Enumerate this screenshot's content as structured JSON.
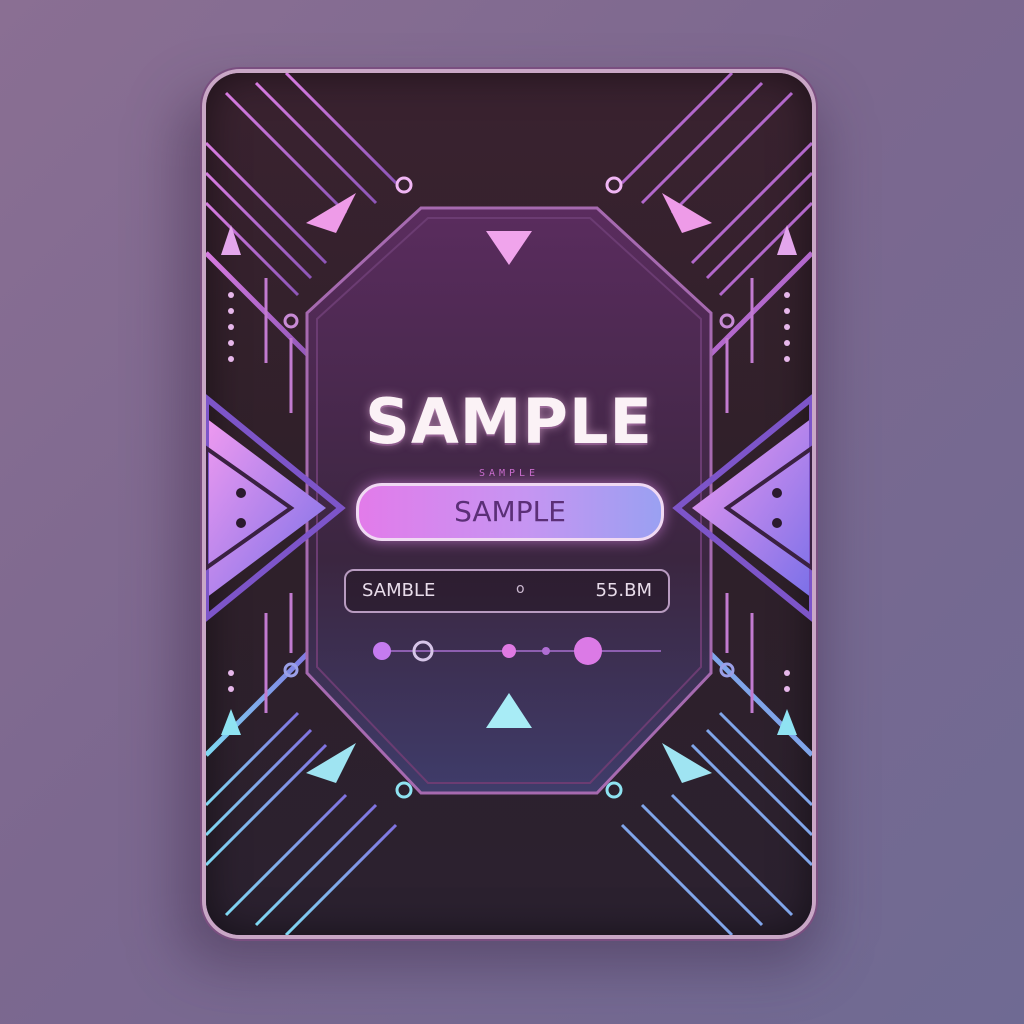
{
  "card": {
    "title": "SAMPLE",
    "subtitle": "SAMPLE",
    "button_label": "SAMPLE",
    "info_label": "SAMBLE",
    "info_mid": "o",
    "info_value": "55.BM"
  },
  "icons": {
    "top_left_arrow": "arrow-down-right-icon",
    "top_right_arrow": "arrow-down-left-icon",
    "bottom_left_arrow": "arrow-up-right-icon",
    "bottom_right_arrow": "arrow-up-left-icon",
    "top_center_arrow": "arrow-down-icon",
    "bottom_center_arrow": "arrow-up-icon"
  },
  "colors": {
    "accent_pink": "#e27bea",
    "accent_purple": "#b48cf0",
    "accent_cyan": "#8fe3f2",
    "card_dark": "#2f2029"
  },
  "slider": {
    "knob_count": 5
  }
}
